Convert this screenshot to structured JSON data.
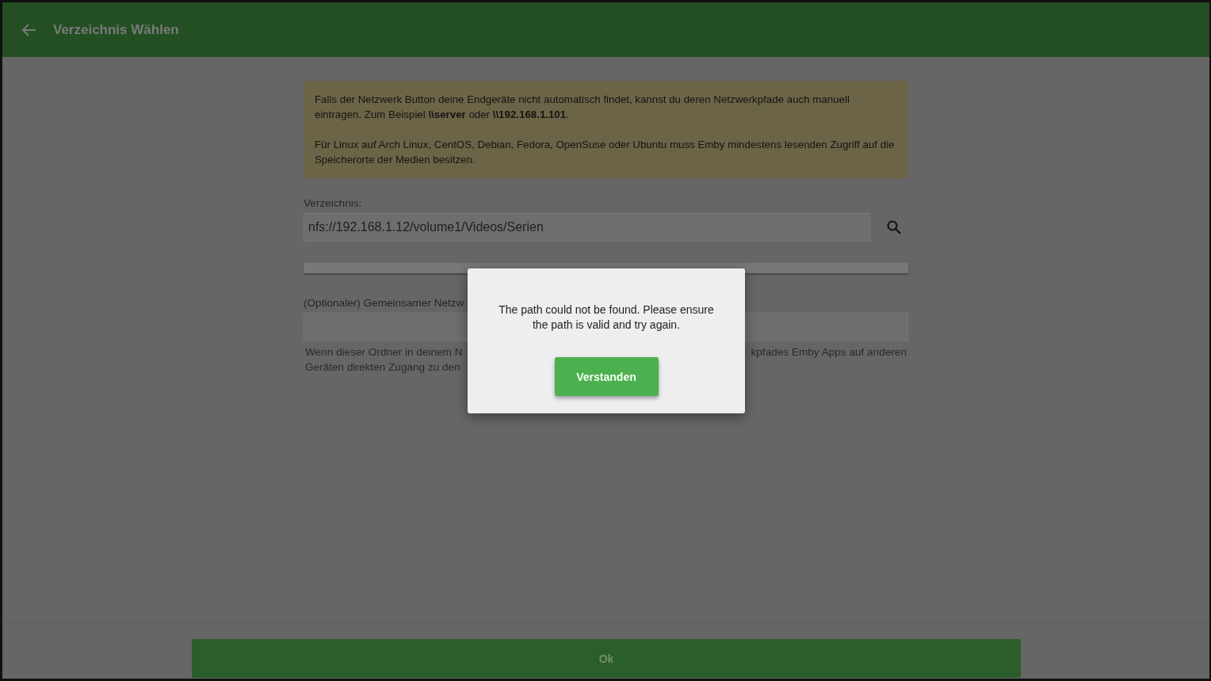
{
  "header": {
    "title": "Verzeichnis Wählen"
  },
  "notice": {
    "paragraphs": [
      "Falls der Netzwerk Button deine Endgeräte nicht automatisch findet, kannst du deren Netzwerkpfade auch manuell eintragen. Zum Beispiel **\\\\server** oder **\\\\192.168.1.101**.",
      "Für Linux auf Arch Linux, CentOS, Debian, Fedora, OpenSuse oder Ubuntu muss Emby mindestens lesenden Zugriff auf die Speicherorte der Medien besitzen."
    ]
  },
  "directory": {
    "label": "Verzeichnis:",
    "value": "nfs://192.168.1.12/volume1/Videos/Serien"
  },
  "share": {
    "label": "(Optionaler) Gemeinsamer Netzw",
    "help_left": [
      "Wenn dieser Ordner in deinem N",
      "Geräten direkten Zugang zu den"
    ],
    "help_right": "kpfades Emby Apps auf anderen"
  },
  "dialog": {
    "message": "The path could not be found. Please ensure the path is valid and try again.",
    "button": "Verstanden"
  },
  "footer": {
    "button": "Ok"
  }
}
